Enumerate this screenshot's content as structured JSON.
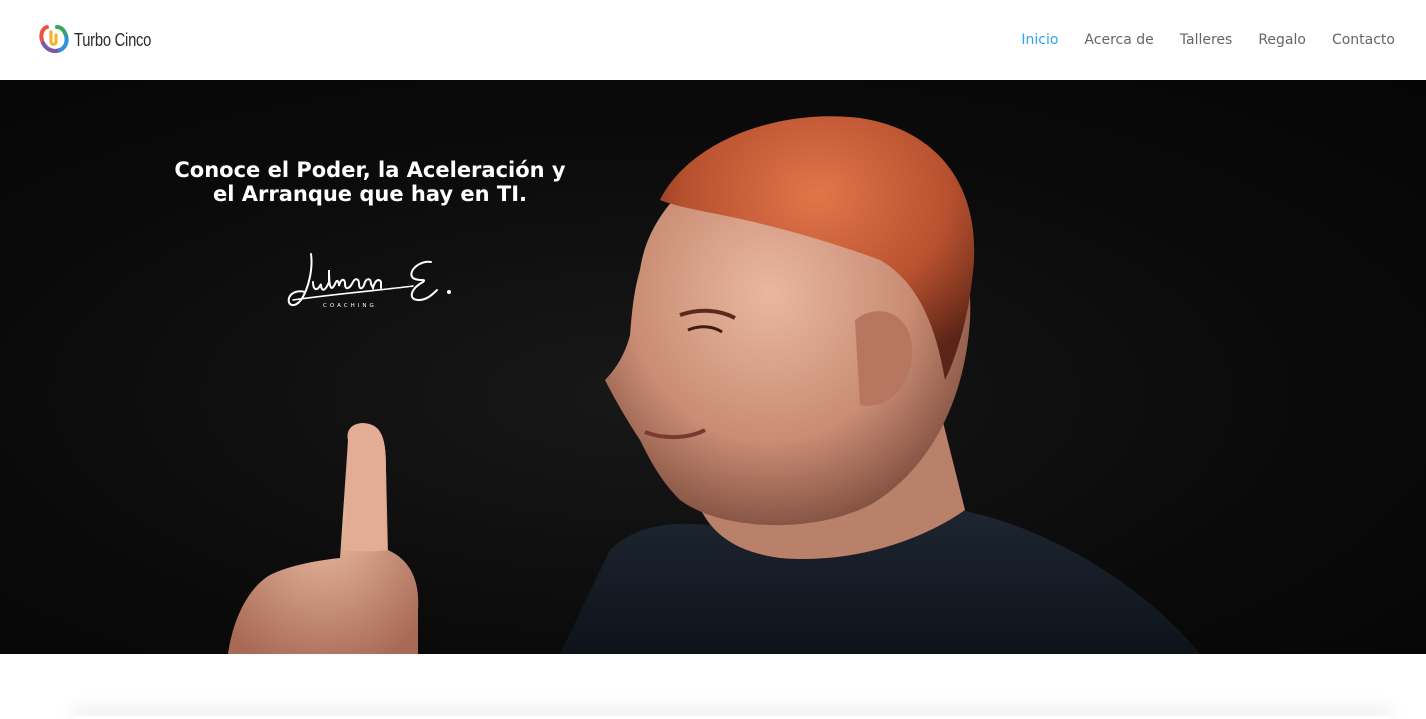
{
  "header": {
    "logo_text": "Turbo Cinco",
    "logo_icon": "turbo-cinco-logo-icon",
    "nav": [
      {
        "label": "Inicio",
        "active": true
      },
      {
        "label": "Acerca de",
        "active": false
      },
      {
        "label": "Talleres",
        "active": false
      },
      {
        "label": "Regalo",
        "active": false
      },
      {
        "label": "Contacto",
        "active": false
      }
    ],
    "active_color": "#2ea3f2",
    "text_color": "#666666"
  },
  "hero": {
    "headline_line1": "Conoce el Poder, la Aceleración y",
    "headline_line2": "el Arranque que hay en TI.",
    "signature_text": "Julian E.",
    "signature_subtext": "COACHING",
    "background_color": "#0b0b0b",
    "photo": "portrait-man-pointing-finger-up"
  }
}
